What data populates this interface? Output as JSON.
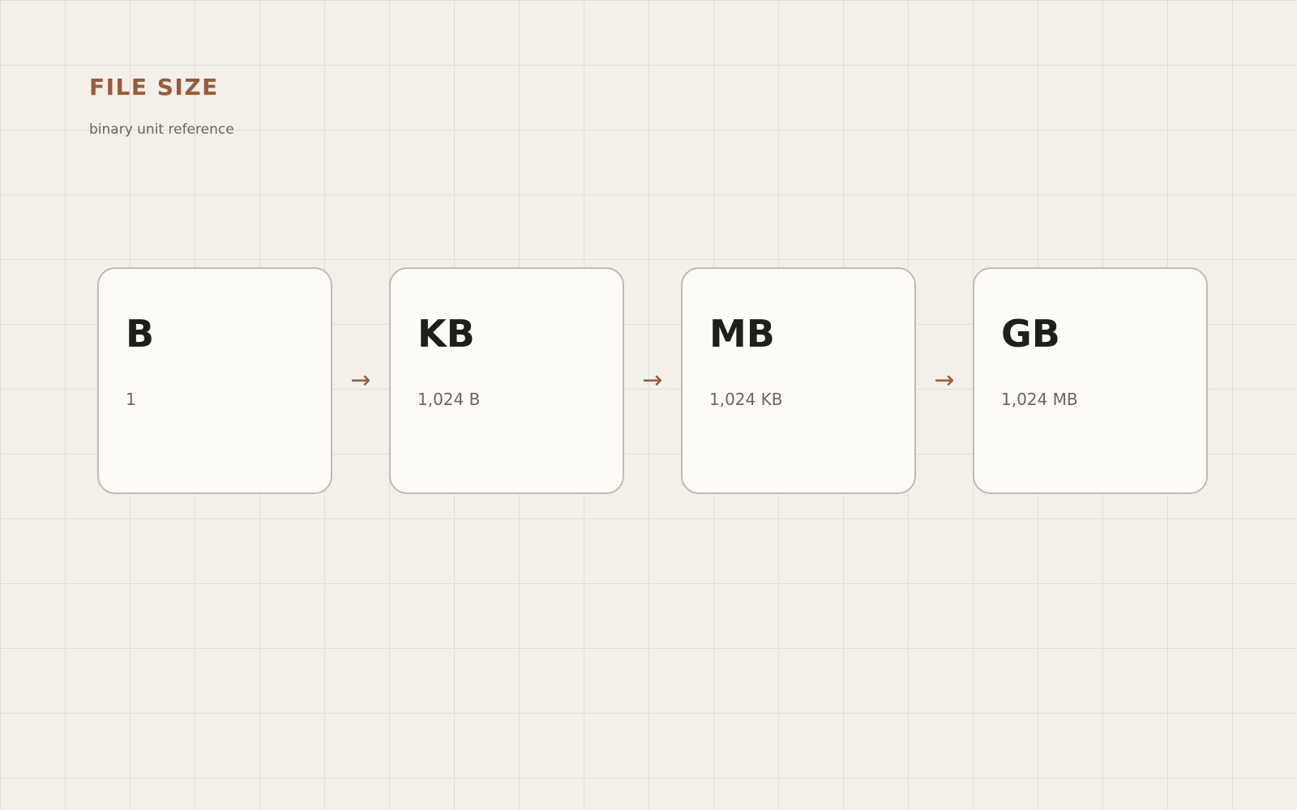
{
  "header": {
    "title": "FILE SIZE",
    "subtitle": "binary unit reference"
  },
  "units": [
    {
      "unit": "B",
      "value": "1"
    },
    {
      "unit": "KB",
      "value": "1,024 B"
    },
    {
      "unit": "MB",
      "value": "1,024 KB"
    },
    {
      "unit": "GB",
      "value": "1,024 MB"
    }
  ],
  "connector": {
    "glyph": "→",
    "icon": "arrow-right-icon"
  },
  "colors": {
    "accent": "#9a5a39",
    "unit_text": "#1f1e1c",
    "muted_text": "#6b6560",
    "card_border": "#c2bab0",
    "card_fill": "#fcfbf8",
    "background": "#f3f0ea"
  }
}
